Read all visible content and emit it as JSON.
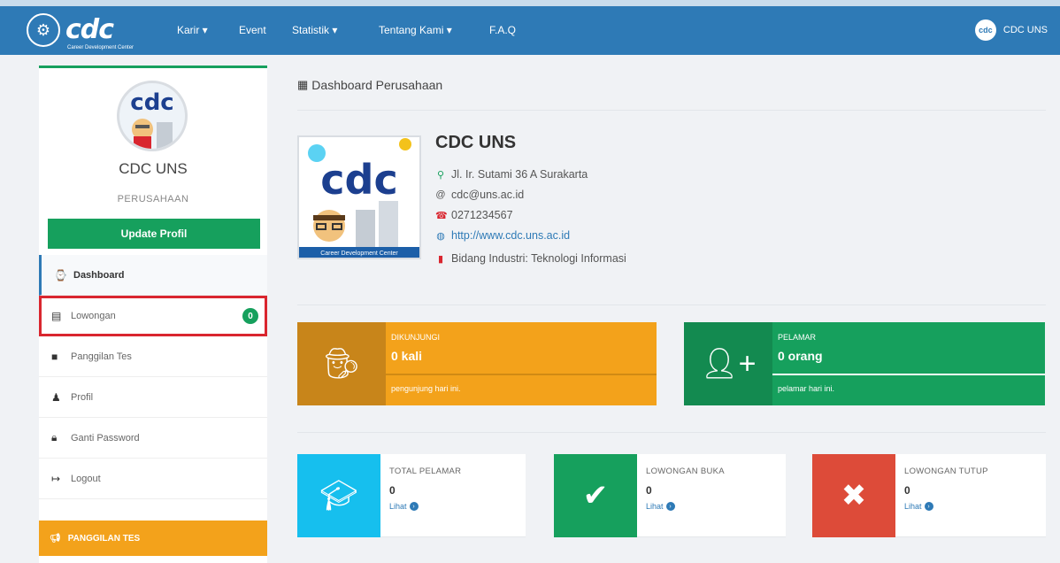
{
  "nav": {
    "logo_text": "cdc",
    "logo_subtitle": "Career Development Center",
    "items": [
      {
        "label": "Karir ▾"
      },
      {
        "label": "Event"
      },
      {
        "label": "Statistik ▾"
      },
      {
        "label": "Tentang Kami ▾"
      },
      {
        "label": "F.A.Q"
      }
    ],
    "user": {
      "name": "CDC UNS",
      "avatar_text": "cdc"
    }
  },
  "sidebar": {
    "avatar_text": "cdc",
    "company_name": "CDC UNS",
    "company_type": "PERUSAHAAN",
    "update_button": "Update Profil",
    "menu": [
      {
        "label": "Dashboard",
        "icon": "tachometer-icon"
      },
      {
        "label": "Lowongan",
        "icon": "file-icon",
        "badge": "0"
      },
      {
        "label": "Panggilan Tes",
        "icon": "comment-icon"
      },
      {
        "label": "Profil",
        "icon": "user-icon"
      },
      {
        "label": "Ganti Password",
        "icon": "lock-icon"
      },
      {
        "label": "Logout",
        "icon": "sign-out-icon"
      }
    ],
    "panggilan_box": "PANGGILAN TES"
  },
  "main": {
    "title": "Dashboard Perusahaan",
    "profile": {
      "logo_text": "cdc",
      "logo_caption": "Career Development Center",
      "name": "CDC UNS",
      "address": "Jl. Ir. Sutami 36 A Surakarta",
      "email": "cdc@uns.ac.id",
      "phone": "0271234567",
      "website": "http://www.cdc.uns.ac.id",
      "industry": "Bidang Industri: Teknologi Informasi"
    },
    "stats_big": [
      {
        "label": "DIKUNJUNGI",
        "value": "0 kali",
        "footer": "pengunjung hari ini.",
        "icon": "user-secret-icon",
        "color_dark": "#c8851a",
        "color_light": "#f3a21b"
      },
      {
        "label": "PELAMAR",
        "value": "0 orang",
        "footer": "pelamar hari ini.",
        "icon": "user-plus-icon",
        "color_dark": "#138a50",
        "color_light": "#16a05d"
      }
    ],
    "stats_small": [
      {
        "label": "TOTAL PELAMAR",
        "value": "0",
        "link": "Lihat",
        "icon": "graduation-cap-icon",
        "color": "#16bfee"
      },
      {
        "label": "LOWONGAN BUKA",
        "value": "0",
        "link": "Lihat",
        "icon": "check-icon",
        "color": "#16a05d"
      },
      {
        "label": "LOWONGAN TUTUP",
        "value": "0",
        "link": "Lihat",
        "icon": "times-icon",
        "color": "#dd4b39"
      }
    ]
  }
}
